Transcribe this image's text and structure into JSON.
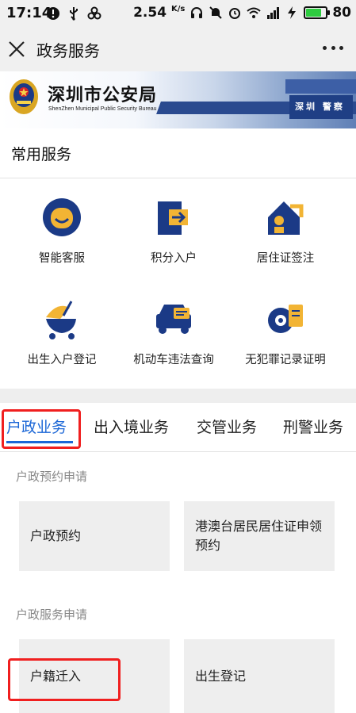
{
  "status_bar": {
    "time": "17:14",
    "speed": "2.54",
    "speed_unit": "K/s",
    "battery_pct": "80",
    "battery_level": 0.8,
    "battery_color": "#2ecc40"
  },
  "nav": {
    "title": "政务服务"
  },
  "banner": {
    "title": "深圳市公安局",
    "subtitle": "ShenZhen Municipal Public Security Bureau",
    "photo_text": "深圳 警察"
  },
  "common_services": {
    "title": "常用服务",
    "items": [
      {
        "label": "智能客服",
        "icon": "smart-service-icon"
      },
      {
        "label": "积分入户",
        "icon": "points-household-icon"
      },
      {
        "label": "居住证签注",
        "icon": "residence-permit-icon"
      },
      {
        "label": "出生入户登记",
        "icon": "birth-registration-icon"
      },
      {
        "label": "机动车违法查询",
        "icon": "vehicle-violation-icon"
      },
      {
        "label": "无犯罪记录证明",
        "icon": "no-criminal-record-icon"
      }
    ]
  },
  "tabs": [
    {
      "label": "户政业务",
      "active": true
    },
    {
      "label": "出入境业务",
      "active": false
    },
    {
      "label": "交管业务",
      "active": false
    },
    {
      "label": "刑警业务",
      "active": false
    }
  ],
  "household": {
    "section1_title": "户政预约申请",
    "section1_cards": [
      "户政预约",
      "港澳台居民居住证申领预约"
    ],
    "section2_title": "户政服务申请",
    "section2_cards": [
      "户籍迁入",
      "出生登记"
    ]
  },
  "colors": {
    "accent": "#1a66d6",
    "highlight_box": "#f01f1f",
    "icon_navy": "#1b3a86",
    "icon_gold": "#f2b434"
  }
}
